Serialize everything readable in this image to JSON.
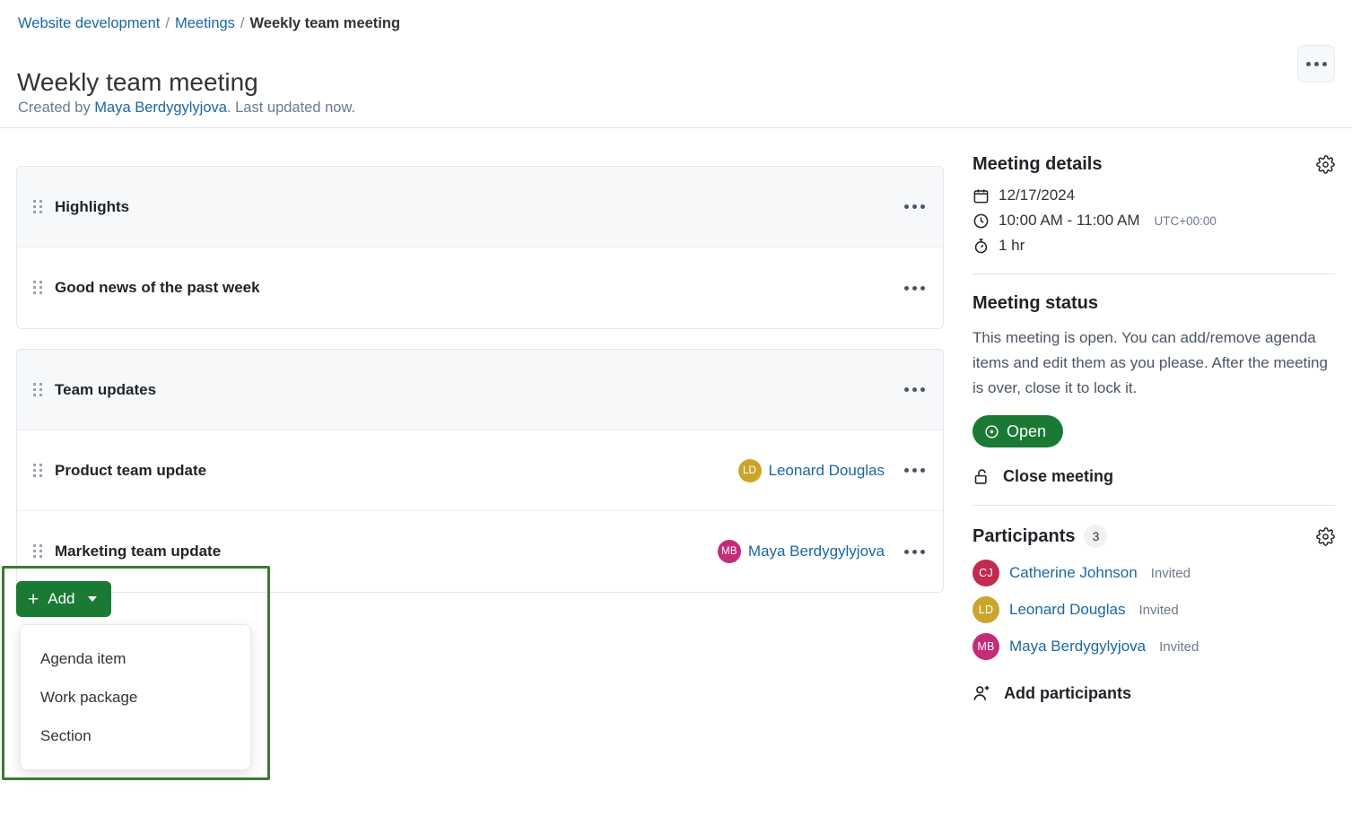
{
  "breadcrumb": {
    "project": "Website development",
    "section": "Meetings",
    "current": "Weekly team meeting",
    "separator": "/"
  },
  "header": {
    "title": "Weekly team meeting",
    "created_prefix": "Created by ",
    "created_by": "Maya Berdygylyjova",
    "created_suffix": ". Last updated now.",
    "more_menu_label": "More"
  },
  "agenda": {
    "sections": [
      {
        "title": "Highlights",
        "items": [
          {
            "title": "Good news of the past week",
            "presenter": null,
            "initials": null,
            "color": null
          }
        ]
      },
      {
        "title": "Team updates",
        "items": [
          {
            "title": "Product team update",
            "presenter": "Leonard Douglas",
            "initials": "LD",
            "color": "#C9A62B"
          },
          {
            "title": "Marketing team update",
            "presenter": "Maya Berdygylyjova",
            "initials": "MB",
            "color": "#C42B79"
          }
        ]
      }
    ]
  },
  "add_control": {
    "label": "Add",
    "plus": "+",
    "menu": [
      {
        "label": "Agenda item"
      },
      {
        "label": "Work package"
      },
      {
        "label": "Section"
      }
    ]
  },
  "meeting_details": {
    "heading": "Meeting details",
    "date": "12/17/2024",
    "time": "10:00 AM - 11:00 AM",
    "timezone": "UTC+00:00",
    "duration": "1 hr",
    "settings_label": "Meeting details settings"
  },
  "meeting_status": {
    "heading": "Meeting status",
    "description": "This meeting is open. You can add/remove agenda items and edit them as you please. After the meeting is over, close it to lock it.",
    "state_label": "Open",
    "close_label": "Close meeting"
  },
  "participants": {
    "heading": "Participants",
    "count": "3",
    "settings_label": "Participants settings",
    "list": [
      {
        "name": "Catherine Johnson",
        "initials": "CJ",
        "status": "Invited",
        "color": "#C02B4E"
      },
      {
        "name": "Leonard Douglas",
        "initials": "LD",
        "status": "Invited",
        "color": "#C9A62B"
      },
      {
        "name": "Maya Berdygylyjova",
        "initials": "MB",
        "status": "Invited",
        "color": "#C42B79"
      }
    ],
    "add_label": "Add participants"
  },
  "colors": {
    "accent_green": "#1A7A34",
    "link_blue": "#1A67A3",
    "highlight_box": "#357C31"
  }
}
